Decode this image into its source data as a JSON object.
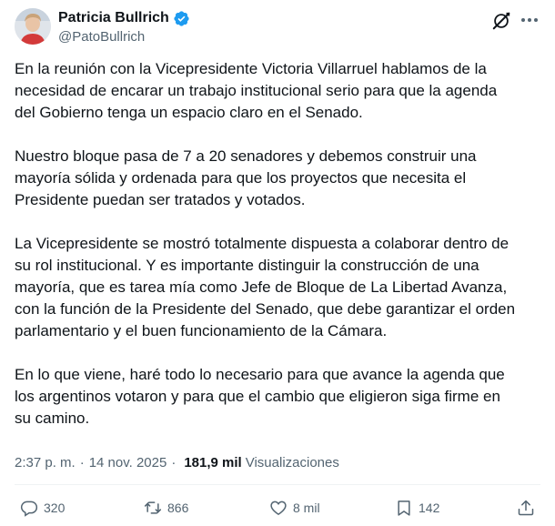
{
  "author": {
    "name": "Patricia Bullrich",
    "handle": "@PatoBullrich"
  },
  "tweet": {
    "paragraphs": [
      "En la reunión con la Vicepresidente Victoria Villarruel hablamos de la\nnecesidad de encarar un trabajo institucional serio para que la agenda\ndel Gobierno tenga un espacio claro en el Senado.",
      "Nuestro bloque pasa de 7 a 20 senadores y debemos construir una\nmayoría sólida y ordenada para que los proyectos que necesita el\nPresidente puedan ser tratados y votados.",
      "La Vicepresidente se mostró totalmente dispuesta a colaborar dentro de\nsu rol institucional. Y es importante distinguir la construcción de una\nmayoría, que es tarea mía como Jefe de Bloque de La Libertad Avanza,\ncon la función de la Presidente del Senado, que debe garantizar el orden\nparlamentario y el buen funcionamiento de la Cámara.",
      "En lo que viene, haré todo lo necesario para que avance la agenda que\nlos argentinos votaron y para que el cambio que eligieron siga firme en\nsu camino."
    ]
  },
  "meta": {
    "time": "2:37 p. m.",
    "separator": "·",
    "date": "14 nov. 2025",
    "views_count": "181,9 mil",
    "views_label": "Visualizaciones"
  },
  "actions": {
    "replies": "320",
    "reposts": "866",
    "likes": "8 mil",
    "bookmarks": "142"
  },
  "colors": {
    "text": "#0f1419",
    "secondary": "#536471",
    "verified": "#1d9bf0"
  }
}
